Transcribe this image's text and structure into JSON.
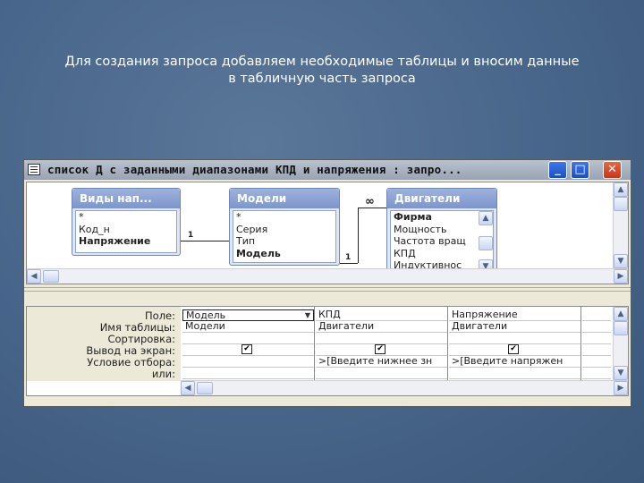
{
  "caption": {
    "line1": "Для создания запроса добавляем необходимые таблицы и вносим данные",
    "line2": "в табличную часть запроса"
  },
  "window": {
    "title": "список Д с заданными диапазонами КПД и напряжения : запро...",
    "controls": {
      "minimize": "_",
      "maximize": "□",
      "close": "✕"
    }
  },
  "tables": [
    {
      "title": "Виды нап...",
      "fields": [
        "*",
        "Код_н",
        "Напряжение"
      ],
      "bold_fields": [
        "Напряжение"
      ]
    },
    {
      "title": "Модели",
      "fields": [
        "*",
        "Серия",
        "Тип",
        "Модель"
      ],
      "bold_fields": [
        "Модель"
      ]
    },
    {
      "title": "Двигатели",
      "fields": [
        "Фирма",
        "Мощность",
        "Частота вращ",
        "КПД",
        "Индуктивнос"
      ],
      "bold_fields": [
        "Фирма"
      ]
    }
  ],
  "relations": {
    "one_label_1": "1",
    "one_label_2": "1",
    "many_label": "∞"
  },
  "grid": {
    "row_labels": [
      "Поле:",
      "Имя таблицы:",
      "Сортировка:",
      "Вывод на экран:",
      "Условие отбора:",
      "или:"
    ],
    "columns": [
      {
        "field": "Модель",
        "table": "Модели",
        "sort": "",
        "show": true,
        "criteria": "",
        "or": ""
      },
      {
        "field": "КПД",
        "table": "Двигатели",
        "sort": "",
        "show": true,
        "criteria": ">[Введите нижнее зн",
        "or": ""
      },
      {
        "field": "Напряжение",
        "table": "Двигатели",
        "sort": "",
        "show": true,
        "criteria": ">[Введите напряжен",
        "or": ""
      }
    ]
  },
  "icons": {
    "window": "query-window-icon",
    "dropdown": "chevron-down-icon",
    "checkmark": "checkmark-icon"
  }
}
